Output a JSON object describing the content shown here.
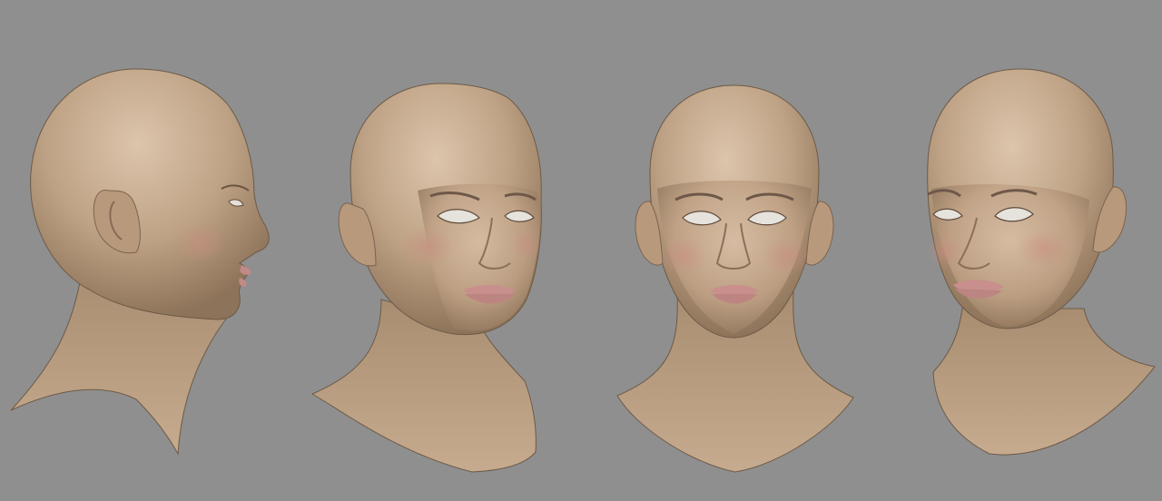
{
  "scene": {
    "background_color": "#8f8f8f",
    "skin_color": "#c8ad91",
    "skin_shadow_color": "#8a7158",
    "lip_color": "#c98f8c",
    "eye_color": "#e6e2dc",
    "views": [
      {
        "name": "left-profile-view",
        "icon": "head-profile"
      },
      {
        "name": "three-quarter-right-view",
        "icon": "head-three-quarter"
      },
      {
        "name": "front-view",
        "icon": "head-front"
      },
      {
        "name": "three-quarter-left-view",
        "icon": "head-three-quarter"
      }
    ]
  }
}
